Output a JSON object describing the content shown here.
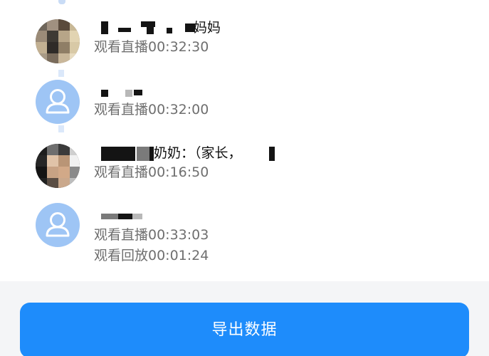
{
  "viewers": [
    {
      "name_suffix": "妈妈",
      "watch_lines": [
        "观看直播00:32:30"
      ]
    },
    {
      "name_suffix": "",
      "watch_lines": [
        "观看直播00:32:00"
      ]
    },
    {
      "name_suffix": "奶奶：（家长，",
      "watch_lines": [
        "观看直播00:16:50"
      ]
    },
    {
      "name_suffix": "",
      "watch_lines": [
        "观看直播00:33:03",
        "观看回放00:01:24"
      ]
    }
  ],
  "footer": {
    "export_label": "导出数据"
  },
  "colors": {
    "accent": "#1e8cfb",
    "default_avatar": "#9ec5f5",
    "secondary_text": "#6f6f6f"
  }
}
